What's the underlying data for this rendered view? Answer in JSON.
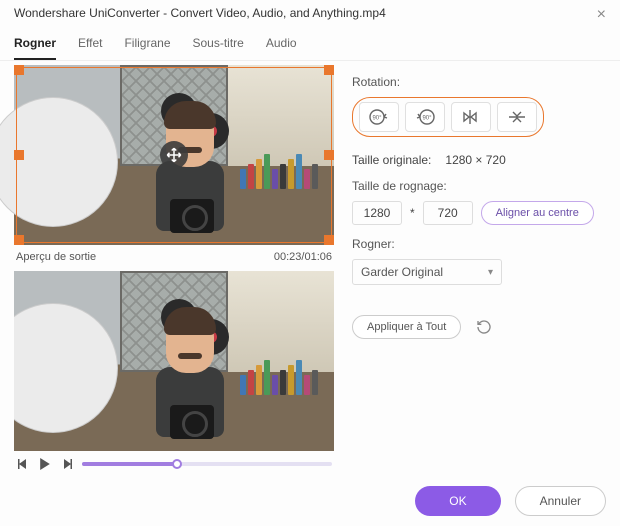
{
  "window_title": "Wondershare UniConverter - Convert Video, Audio, and Anything.mp4",
  "tabs": [
    "Rogner",
    "Effet",
    "Filigrane",
    "Sous-titre",
    "Audio"
  ],
  "active_tab": 0,
  "preview_label": "Aperçu de sortie",
  "time": "00:23/01:06",
  "rotation_label": "Rotation:",
  "original_size_label": "Taille originale:",
  "original_size_value": "1280 × 720",
  "crop_size_label": "Taille de rognage:",
  "crop_w": "1280",
  "star": "*",
  "crop_h": "720",
  "center_btn": "Aligner au centre",
  "rogner_label": "Rogner:",
  "rogner_value": "Garder Original",
  "apply_btn": "Appliquer à Tout",
  "ok": "OK",
  "cancel": "Annuler",
  "book_colors": [
    "#4177b5",
    "#c34444",
    "#d79a3a",
    "#4a9a58",
    "#6a4ea8",
    "#3a3a3a",
    "#c79a2d",
    "#4a89b5",
    "#b54a77",
    "#5a5a5a"
  ]
}
